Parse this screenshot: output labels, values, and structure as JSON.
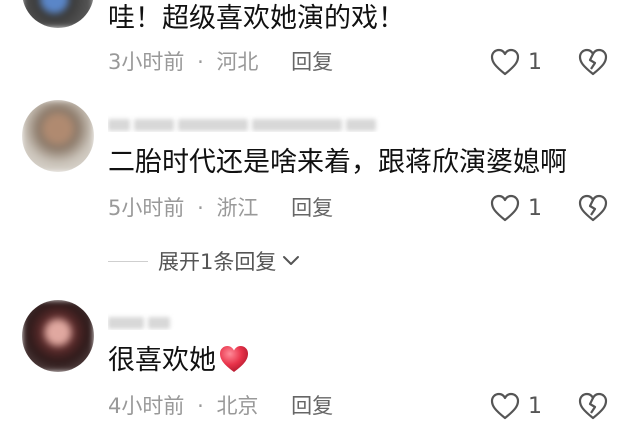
{
  "comments": [
    {
      "text": "哇！超级喜欢她演的戏！",
      "time": "3小时前",
      "sep": "·",
      "location": "河北",
      "reply": "回复",
      "likes": "1"
    },
    {
      "text": "二胎时代还是啥来着，跟蒋欣演婆媳啊",
      "time": "5小时前",
      "sep": "·",
      "location": "浙江",
      "reply": "回复",
      "likes": "1",
      "expand_label": "展开1条回复"
    },
    {
      "text": "很喜欢她",
      "time": "4小时前",
      "sep": "·",
      "location": "北京",
      "reply": "回复",
      "likes": "1",
      "emoji": "red-heart-emoji"
    }
  ],
  "colors": {
    "text": "#111111",
    "meta": "#999999",
    "icon": "#555555",
    "heart_emoji": "#e8334a"
  }
}
